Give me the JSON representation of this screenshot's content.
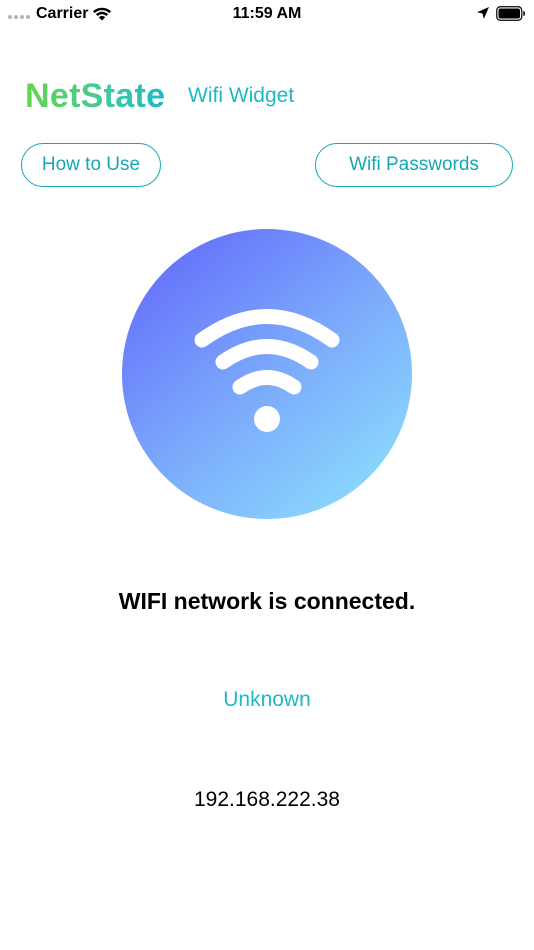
{
  "status_bar": {
    "carrier": "Carrier",
    "time": "11:59 AM",
    "icons": [
      "signal-dots",
      "wifi-icon",
      "location-arrow-icon",
      "battery-icon"
    ]
  },
  "header": {
    "brand": "NetState",
    "subtitle": "Wifi Widget"
  },
  "buttons": {
    "how_to_use": "How to Use",
    "wifi_passwords": "Wifi Passwords"
  },
  "main": {
    "icon": "wifi-icon",
    "status": "WIFI network is connected.",
    "network_name": "Unknown",
    "ip_address": "192.168.222.38"
  },
  "colors": {
    "accent": "#1fb8c6",
    "brand_gradient_start": "#66d44e",
    "brand_gradient_end": "#18bcc7",
    "circle_gradient_start": "#5f63fb",
    "circle_gradient_end": "#8de6fe"
  }
}
